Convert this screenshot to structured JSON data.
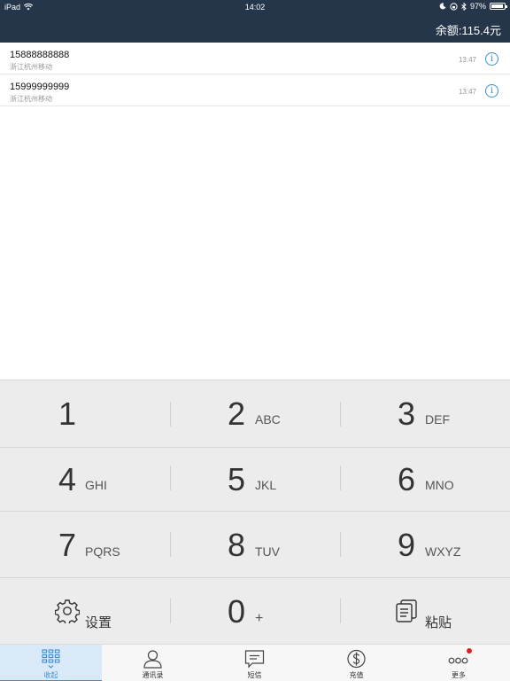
{
  "status_bar": {
    "device": "iPad",
    "time": "14:02",
    "battery": "97%"
  },
  "header": {
    "balance": "余额:115.4元"
  },
  "calls": [
    {
      "number": "15888888888",
      "location": "浙江杭州移动",
      "time": "13:47"
    },
    {
      "number": "15999999999",
      "location": "浙江杭州移动",
      "time": "13:47"
    }
  ],
  "keypad": {
    "rows": [
      [
        {
          "digit": "1",
          "letters": ""
        },
        {
          "digit": "2",
          "letters": "ABC"
        },
        {
          "digit": "3",
          "letters": "DEF"
        }
      ],
      [
        {
          "digit": "4",
          "letters": "GHI"
        },
        {
          "digit": "5",
          "letters": "JKL"
        },
        {
          "digit": "6",
          "letters": "MNO"
        }
      ],
      [
        {
          "digit": "7",
          "letters": "PQRS"
        },
        {
          "digit": "8",
          "letters": "TUV"
        },
        {
          "digit": "9",
          "letters": "WXYZ"
        }
      ]
    ],
    "settings_label": "设置",
    "zero_digit": "0",
    "zero_symbol": "+",
    "paste_label": "粘贴"
  },
  "tabs": [
    {
      "label": "收起",
      "icon": "keypad-collapse-icon",
      "active": true
    },
    {
      "label": "通讯录",
      "icon": "contacts-icon",
      "active": false
    },
    {
      "label": "短信",
      "icon": "message-icon",
      "active": false
    },
    {
      "label": "充值",
      "icon": "dollar-icon",
      "active": false
    },
    {
      "label": "更多",
      "icon": "more-icon",
      "active": false
    }
  ],
  "colors": {
    "header_bg": "#26364a",
    "accent": "#3a8fd8",
    "badge": "#e02020"
  }
}
